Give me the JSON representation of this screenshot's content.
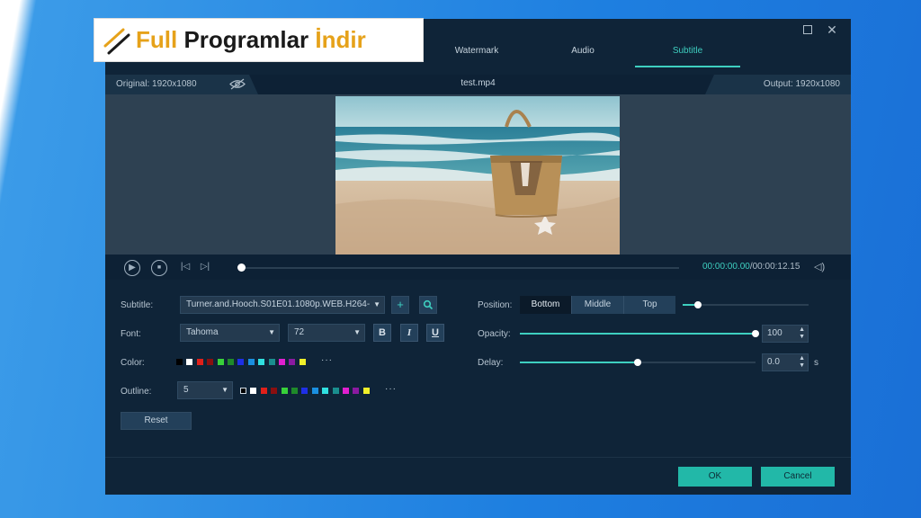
{
  "logo": {
    "word1": "Full",
    "word2": "Programlar",
    "word3": "İndir"
  },
  "tabs": [
    {
      "label": "Watermark",
      "active": false
    },
    {
      "label": "Audio",
      "active": false
    },
    {
      "label": "Subtitle",
      "active": true
    }
  ],
  "window_controls": {
    "maximize_icon": "maximize-icon",
    "close_icon": "close-icon",
    "close_glyph": "✕"
  },
  "info_bar": {
    "original": "Original: 1920x1080",
    "filename": "test.mp4",
    "output": "Output: 1920x1080"
  },
  "player": {
    "current_time": "00:00:00.00",
    "total_time": "/00:00:12.15",
    "progress": 0.0,
    "play_glyph": "▶",
    "stop_glyph": "■",
    "prev_glyph": "|◁",
    "next_glyph": "▷|",
    "volume_glyph": "◁)"
  },
  "subtitle": {
    "label": "Subtitle:",
    "value": "Turner.and.Hooch.S01E01.1080p.WEB.H264-",
    "add_glyph": "+",
    "search_glyph": "⌕"
  },
  "font": {
    "label": "Font:",
    "family": "Tahoma",
    "size": "72",
    "bold": "B",
    "italic": "I",
    "underline": "U"
  },
  "color": {
    "label": "Color:",
    "swatches": [
      "#000000",
      "#ffffff",
      "#e0201a",
      "#8a0f10",
      "#38d13a",
      "#1f8a2a",
      "#1e2fe6",
      "#1a8fe0",
      "#30e0e0",
      "#1a8e8e",
      "#e020d0",
      "#8a1aa0",
      "#f0f02a"
    ],
    "more": "···"
  },
  "outline": {
    "label": "Outline:",
    "value": "5",
    "swatches": [
      "#000000",
      "#ffffff",
      "#e0201a",
      "#8a0f10",
      "#38d13a",
      "#1f8a2a",
      "#1e2fe6",
      "#1a8fe0",
      "#30e0e0",
      "#1a8e8e",
      "#e020d0",
      "#8a1aa0",
      "#f0f02a"
    ],
    "more": "···"
  },
  "reset_label": "Reset",
  "position": {
    "label": "Position:",
    "options": [
      "Bottom",
      "Middle",
      "Top"
    ],
    "selected": "Bottom",
    "slider_value": 0.12
  },
  "opacity": {
    "label": "Opacity:",
    "value": "100",
    "fraction": 1.0
  },
  "delay": {
    "label": "Delay:",
    "value": "0.0",
    "unit": "s",
    "fraction": 0.5
  },
  "buttons": {
    "ok": "OK",
    "cancel": "Cancel"
  },
  "colors": {
    "accent": "#3ecfc0",
    "window_bg": "#0f2438",
    "logo_orange": "#e6a21a"
  }
}
